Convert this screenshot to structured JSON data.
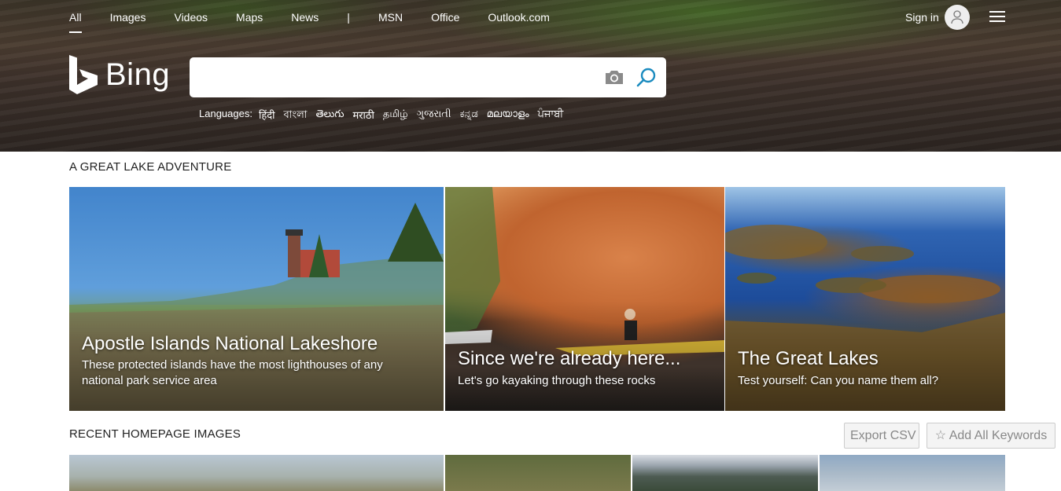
{
  "nav": {
    "items": [
      "All",
      "Images",
      "Videos",
      "Maps",
      "News"
    ],
    "separator": "|",
    "extra": [
      "MSN",
      "Office",
      "Outlook.com"
    ],
    "sign_in": "Sign in"
  },
  "logo": {
    "text": "Bing"
  },
  "search": {
    "value": "",
    "placeholder": ""
  },
  "languages": {
    "label": "Languages:",
    "items": [
      "हिंदी",
      "বাংলা",
      "తెలుగు",
      "मराठी",
      "தமிழ்",
      "ગુજરાતી",
      "ಕನ್ನಡ",
      "മലയാളം",
      "ਪੰਜਾਬੀ"
    ]
  },
  "featured": {
    "title": "A GREAT LAKE ADVENTURE",
    "cards": [
      {
        "title": "Apostle Islands National Lakeshore",
        "subtitle": "These protected islands have the most lighthouses of any national park service area"
      },
      {
        "title": "Since we're already here...",
        "subtitle": "Let's go kayaking through these rocks"
      },
      {
        "title": "The Great Lakes",
        "subtitle": "Test yourself: Can you name them all?"
      }
    ]
  },
  "recent": {
    "title": "RECENT HOMEPAGE IMAGES",
    "export_label": "Export CSV",
    "keywords_label": "Add All Keywords"
  },
  "colors": {
    "accent": "#1b8bbf",
    "hero_dark": "#3b3428"
  },
  "icons": [
    "bing-logo-icon",
    "camera-icon",
    "search-icon",
    "user-icon",
    "hamburger-menu-icon",
    "star-icon"
  ]
}
